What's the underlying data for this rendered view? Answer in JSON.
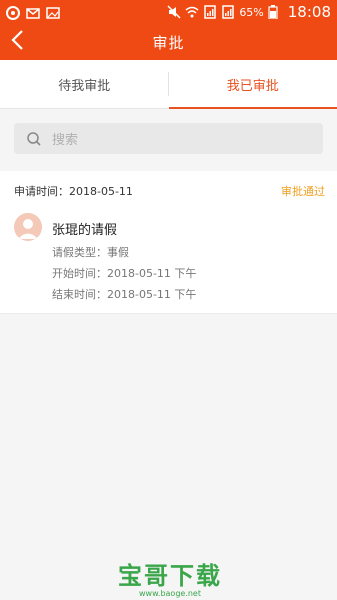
{
  "status_bar": {
    "battery": "65%",
    "time": "18:08"
  },
  "app_bar": {
    "title": "审批"
  },
  "tabs": [
    {
      "label": "待我审批",
      "active": false
    },
    {
      "label": "我已审批",
      "active": true
    }
  ],
  "search": {
    "placeholder": "搜索"
  },
  "records": [
    {
      "apply_time": "申请时间：2018-05-11",
      "status": "审批通过",
      "title": "张琨的请假",
      "leave_type": "请假类型：事假",
      "start_time": "开始时间：2018-05-11  下午",
      "end_time": "结束时间：2018-05-11  下午"
    }
  ],
  "colors": {
    "accent": "#f04a14",
    "status_approved": "#f0a020",
    "watermark": "#3aa64a"
  },
  "watermark": {
    "main": "宝哥下载",
    "url": "www.baoge.net"
  }
}
